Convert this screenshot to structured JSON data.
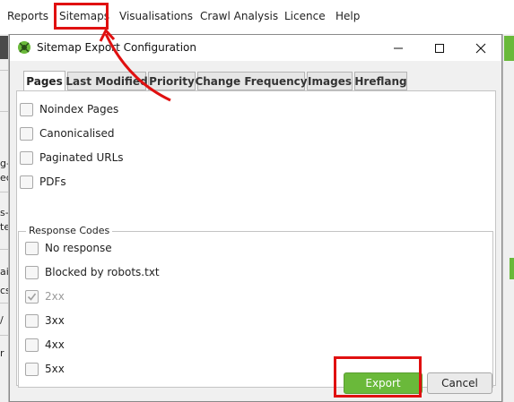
{
  "menubar": {
    "items": [
      "Reports",
      "Sitemaps",
      "Visualisations",
      "Crawl Analysis",
      "Licence",
      "Help"
    ]
  },
  "background": {
    "left_fragments": [
      "g-(",
      "ec",
      "s-",
      "te",
      "ai",
      "cs",
      "/",
      "r"
    ]
  },
  "dialog": {
    "title": "Sitemap Export Configuration",
    "window_buttons": {
      "minimize": "–",
      "maximize": "☐",
      "close": "✕"
    },
    "tabs": [
      "Pages",
      "Last Modified",
      "Priority",
      "Change Frequency",
      "Images",
      "Hreflang"
    ],
    "active_tab": "Pages",
    "page_options": [
      {
        "label": "Noindex Pages",
        "checked": false
      },
      {
        "label": "Canonicalised",
        "checked": false
      },
      {
        "label": "Paginated URLs",
        "checked": false
      },
      {
        "label": "PDFs",
        "checked": false
      }
    ],
    "response_codes": {
      "title": "Response Codes",
      "items": [
        {
          "label": "No response",
          "checked": false,
          "disabled": false
        },
        {
          "label": "Blocked by robots.txt",
          "checked": false,
          "disabled": false
        },
        {
          "label": "2xx",
          "checked": true,
          "disabled": true
        },
        {
          "label": "3xx",
          "checked": false,
          "disabled": false
        },
        {
          "label": "4xx",
          "checked": false,
          "disabled": false
        },
        {
          "label": "5xx",
          "checked": false,
          "disabled": false
        }
      ]
    },
    "buttons": {
      "export": "Export",
      "cancel": "Cancel"
    }
  },
  "colors": {
    "highlight": "#e01010",
    "export_green": "#6ab93a",
    "app_green": "#69b93a"
  }
}
